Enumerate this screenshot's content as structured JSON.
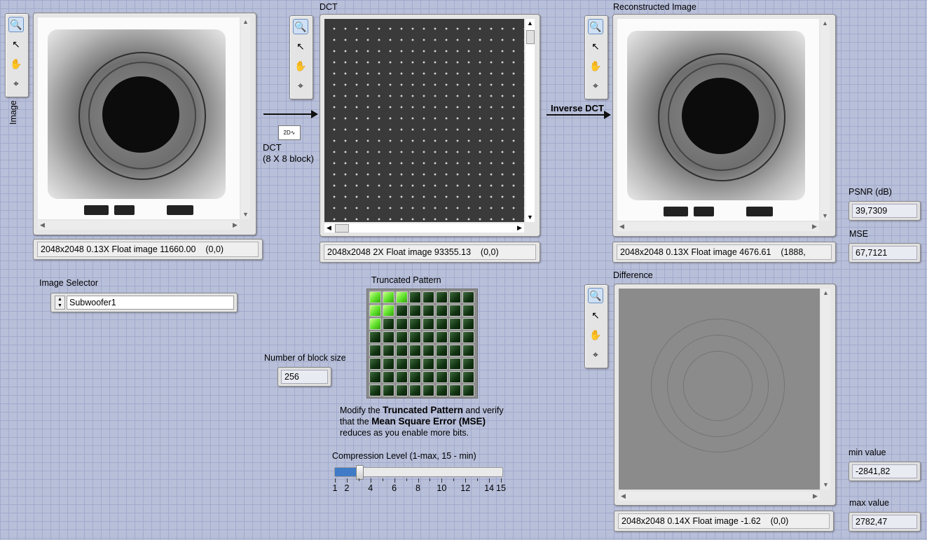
{
  "labels": {
    "image": "Image",
    "dct": "DCT",
    "reconstructed": "Reconstructed Image",
    "difference": "Difference",
    "psnr": "PSNR (dB)",
    "mse": "MSE",
    "min_value": "min value",
    "max_value": "max value",
    "image_selector": "Image Selector",
    "truncated_pattern": "Truncated Pattern",
    "block_size": "Number of block size",
    "compression": "Compression Level (1-max, 15 - min)",
    "inverse_dct": "Inverse DCT",
    "dct_node_line1": "DCT",
    "dct_node_line2": "(8 X 8 block)"
  },
  "info_bars": {
    "image": "2048x2048 0.13X Float image 11660.00    (0,0)",
    "dct": "2048x2048 2X Float image 93355.13    (0,0)",
    "reconstructed": "2048x2048 0.13X Float image 4676.61    (1888,",
    "difference": "2048x2048 0.14X Float image -1.62    (0,0)"
  },
  "indicators": {
    "psnr": "39,7309",
    "mse": "67,7121",
    "min_value": "-2841,82",
    "max_value": "2782,47",
    "block_size": "256"
  },
  "image_selector": {
    "value": "Subwoofer1"
  },
  "instructions": {
    "p1": "Modify the ",
    "b1": "Truncated Pattern",
    "p2": "  and verify",
    "p3": "that the ",
    "b2": "Mean Square Error (MSE)",
    "p4": "reduces as you enable more bits."
  },
  "truncated_pattern": {
    "rows": 8,
    "cols": 8,
    "on": [
      [
        1,
        1,
        1,
        0,
        0,
        0,
        0,
        0
      ],
      [
        1,
        1,
        0,
        0,
        0,
        0,
        0,
        0
      ],
      [
        1,
        0,
        0,
        0,
        0,
        0,
        0,
        0
      ],
      [
        0,
        0,
        0,
        0,
        0,
        0,
        0,
        0
      ],
      [
        0,
        0,
        0,
        0,
        0,
        0,
        0,
        0
      ],
      [
        0,
        0,
        0,
        0,
        0,
        0,
        0,
        0
      ],
      [
        0,
        0,
        0,
        0,
        0,
        0,
        0,
        0
      ],
      [
        0,
        0,
        0,
        0,
        0,
        0,
        0,
        0
      ]
    ]
  },
  "compression_slider": {
    "min": 1,
    "max": 15,
    "value": 3,
    "tick_labels": [
      "1",
      "2",
      "4",
      "6",
      "8",
      "10",
      "12",
      "14",
      "15"
    ]
  },
  "tools": [
    "zoom-icon",
    "pointer-icon",
    "pan-hand-icon",
    "crosshair-icon"
  ],
  "colors": {
    "led_on": "#5de02a",
    "led_off": "#113311",
    "slider_fill": "#3f7bc7"
  }
}
